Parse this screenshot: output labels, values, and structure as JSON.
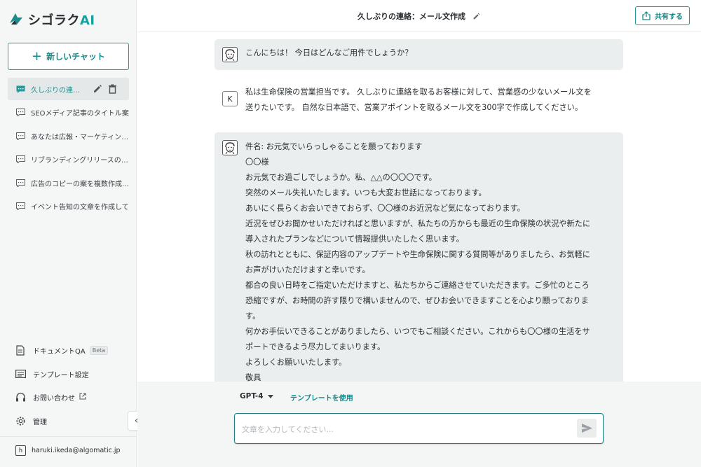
{
  "app": {
    "logo_main": "シゴラク",
    "logo_ai": "AI"
  },
  "sidebar": {
    "new_chat_label": "新しいチャット",
    "history": [
      {
        "label": "久しぶりの連絡：メール文作成",
        "active": true
      },
      {
        "label": "SEOメディア記事のタイトル案",
        "active": false
      },
      {
        "label": "あなたは広報・マーケティング担当",
        "active": false
      },
      {
        "label": "リブランディングリリースの作成",
        "active": false
      },
      {
        "label": "広告のコピーの案を複数作成して",
        "active": false
      },
      {
        "label": "イベント告知の文章を作成して",
        "active": false
      }
    ],
    "menu": {
      "docqa": "ドキュメントQA",
      "docqa_badge": "Beta",
      "templates": "テンプレート設定",
      "contact": "お問い合わせ",
      "settings": "管理"
    },
    "user": {
      "initial": "h",
      "email": "haruki.ikeda@algomatic.jp"
    }
  },
  "header": {
    "title": "久しぶりの連絡：メール文作成",
    "share_label": "共有する"
  },
  "messages": {
    "greeting": "こんにちは！ 今日はどんなご用件でしょうか？",
    "user_initial": "K",
    "user_line1": "私は生命保険の営業担当です。 久しぶりに連絡を取るお客様に対して、営業感の少ないメール文を",
    "user_line2": "送りたいです。 自然な日本語で、営業アポイントを取るメール文を300字で作成してください。",
    "reply_lines": [
      "件名: お元気でいらっしゃることを願っております",
      "〇〇様",
      "お元気でお過ごしでしょうか。私、△△の〇〇〇です。",
      "突然のメール失礼いたします。いつも大変お世話になっております。",
      "あいにく長らくお会いできておらず、〇〇様のお近況など気になっております。",
      "近況をぜひお聞かせいただければと思いますが、私たちの方からも最近の生命保険の状況や新たに",
      "導入されたプランなどについて情報提供いたしたく思います。",
      "秋の訪れとともに、保証内容のアップデートや生命保険に関する質問等がありましたら、お気軽に",
      "お声がけいただけますと幸いです。",
      "都合の良い日時をご指定いただけますと、私たちからご連絡させていただきます。ご多忙のところ",
      "恐縮ですが、お時間の許す限りで構いませんので、ぜひお会いできますことを心より願っておりま",
      "す。",
      "何かお手伝いできることがありましたら、いつでもご相談ください。これからも〇〇様の生活をサ",
      "ポートできるよう尽力してまいります。",
      "よろしくお願いいたします。",
      "敬具"
    ]
  },
  "composer": {
    "model": "GPT-4",
    "template_link": "テンプレートを使用",
    "placeholder": "文章を入力してください...",
    "value": ""
  },
  "colors": {
    "accent": "#1f9b9c",
    "ai_bubble": "#eaeeee",
    "sidebar_bg": "#f5f6f6"
  }
}
